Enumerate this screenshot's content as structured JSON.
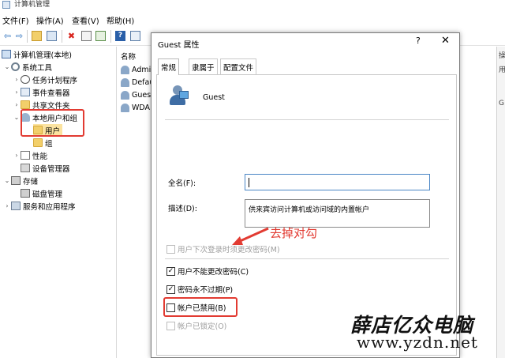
{
  "window": {
    "title": "计算机管理"
  },
  "menu": [
    "文件(F)",
    "操作(A)",
    "查看(V)",
    "帮助(H)"
  ],
  "toolbar_icons": [
    "back-icon",
    "forward-icon",
    "up-folder-icon",
    "show-tree-icon",
    "delete-icon",
    "properties-icon",
    "export-icon",
    "help-icon",
    "view-icon"
  ],
  "tree": {
    "root": "计算机管理(本地)",
    "system_tools": "系统工具",
    "task_scheduler": "任务计划程序",
    "event_viewer": "事件查看器",
    "shared_folders": "共享文件夹",
    "local_users": "本地用户和组",
    "users": "用户",
    "groups": "组",
    "performance": "性能",
    "device_manager": "设备管理器",
    "storage": "存储",
    "disk_management": "磁盘管理",
    "services_apps": "服务和应用程序"
  },
  "list": {
    "column_name": "名称",
    "items": [
      "Admi",
      "Defau",
      "Guest",
      "WDA"
    ]
  },
  "right_panel": [
    "操",
    "用",
    "G"
  ],
  "dialog": {
    "title": "Guest 属性",
    "help": "?",
    "close": "✕",
    "tabs": [
      "常规",
      "隶属于",
      "配置文件"
    ],
    "username": "Guest",
    "fullname_label": "全名(F):",
    "fullname_value": "",
    "description_label": "描述(D):",
    "description_value": "供来宾访问计算机或访问域的内置帐户",
    "options": [
      {
        "label": "用户下次登录时须更改密码(M)",
        "checked": false,
        "disabled": true
      },
      {
        "label": "用户不能更改密码(C)",
        "checked": true,
        "disabled": false
      },
      {
        "label": "密码永不过期(P)",
        "checked": true,
        "disabled": false
      },
      {
        "label": "帐户已禁用(B)",
        "checked": false,
        "disabled": false
      },
      {
        "label": "帐户已锁定(O)",
        "checked": false,
        "disabled": true
      }
    ]
  },
  "annotation": {
    "text": "去掉对勾",
    "color": "#e23b32"
  },
  "watermark": {
    "line1": "薛店亿众电脑",
    "line2": "www.yzdn.net"
  }
}
